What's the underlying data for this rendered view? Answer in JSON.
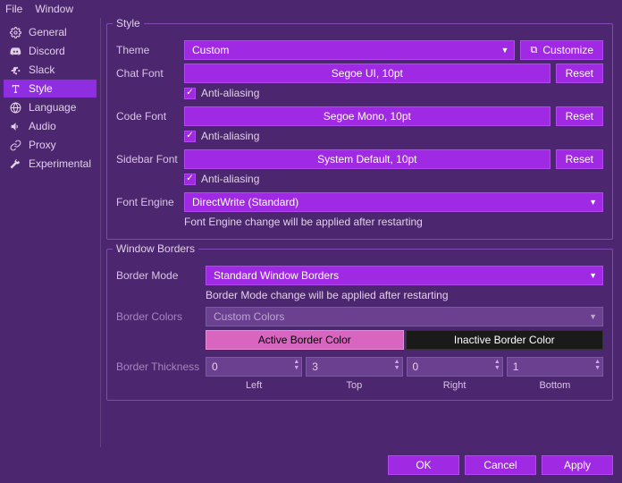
{
  "menubar": {
    "file": "File",
    "window": "Window"
  },
  "sidebar": {
    "items": [
      {
        "label": "General"
      },
      {
        "label": "Discord"
      },
      {
        "label": "Slack"
      },
      {
        "label": "Style"
      },
      {
        "label": "Language"
      },
      {
        "label": "Audio"
      },
      {
        "label": "Proxy"
      },
      {
        "label": "Experimental"
      }
    ]
  },
  "style": {
    "title": "Style",
    "theme_label": "Theme",
    "theme_value": "Custom",
    "customize": "Customize",
    "chat_font_label": "Chat Font",
    "chat_font_value": "Segoe UI, 10pt",
    "code_font_label": "Code Font",
    "code_font_value": "Segoe Mono, 10pt",
    "sidebar_font_label": "Sidebar Font",
    "sidebar_font_value": "System Default, 10pt",
    "antialias": "Anti-aliasing",
    "reset": "Reset",
    "engine_label": "Font Engine",
    "engine_value": "DirectWrite (Standard)",
    "engine_note": "Font Engine change will be applied after restarting"
  },
  "borders": {
    "title": "Window Borders",
    "mode_label": "Border Mode",
    "mode_value": "Standard Window Borders",
    "mode_note": "Border Mode change will be applied after restarting",
    "colors_label": "Border Colors",
    "colors_value": "Custom Colors",
    "active": "Active Border Color",
    "inactive": "Inactive Border Color",
    "thickness_label": "Border Thickness",
    "vals": {
      "left": "0",
      "top": "3",
      "right": "0",
      "bottom": "1"
    },
    "labels": {
      "left": "Left",
      "top": "Top",
      "right": "Right",
      "bottom": "Bottom"
    }
  },
  "footer": {
    "ok": "OK",
    "cancel": "Cancel",
    "apply": "Apply"
  }
}
